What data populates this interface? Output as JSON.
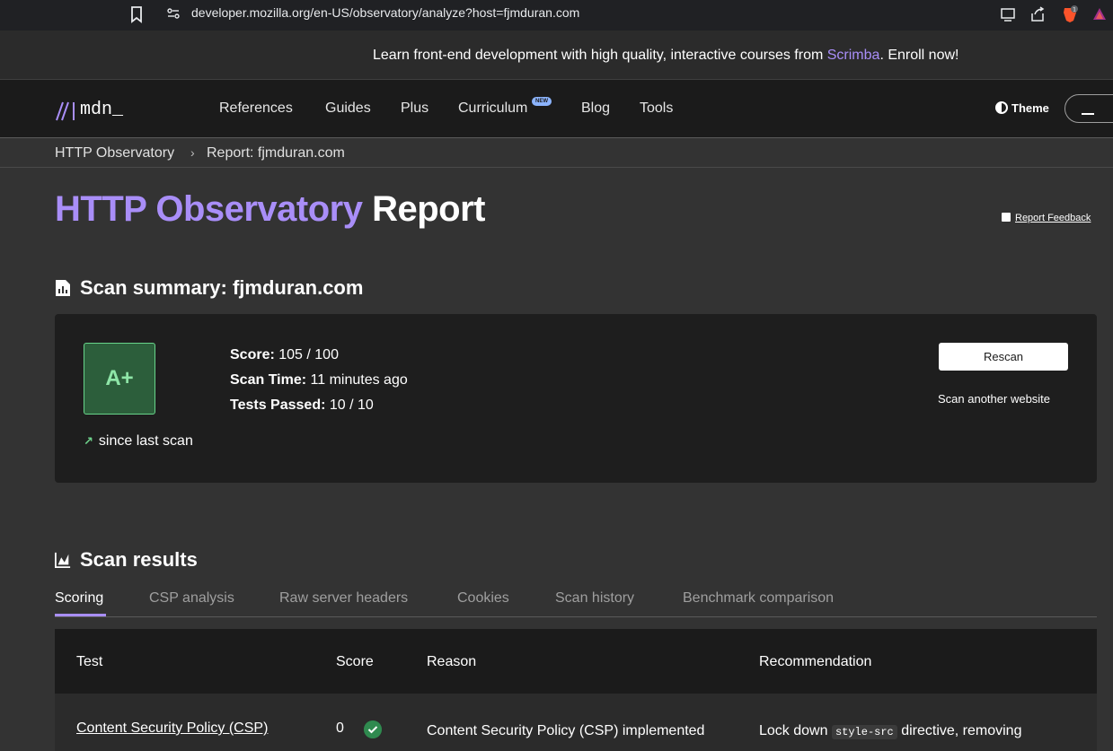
{
  "browser": {
    "url": "developer.mozilla.org/en-US/observatory/analyze?host=fjmduran.com",
    "icons": [
      "bookmark-icon",
      "site-info-icon",
      "install-icon",
      "share-icon",
      "brave-shield-icon",
      "brave-rewards-icon"
    ],
    "shield_count": "1"
  },
  "banner": {
    "before": "Learn front-end development with high quality, interactive courses from ",
    "link": "Scrimba",
    "after": ". Enroll now!"
  },
  "nav": {
    "logo": "mdn_",
    "items": [
      "References",
      "Guides",
      "Plus",
      "Curriculum",
      "Blog",
      "Tools"
    ],
    "new_badge": "NEW",
    "theme": "Theme"
  },
  "breadcrumb": {
    "items": [
      "HTTP Observatory",
      "Report: fjmduran.com"
    ],
    "separator": "›"
  },
  "title": {
    "accent": "HTTP Observatory",
    "rest": " Report"
  },
  "feedback": "Report Feedback",
  "summary": {
    "heading_bold": "Scan summary:",
    "heading_host": " fjmduran.com",
    "grade": "A+",
    "since_last_scan": "since last scan",
    "score_label": "Score:",
    "score_value": " 105 / 100",
    "scan_time_label": "Scan Time:",
    "scan_time_value": " 11 minutes ago",
    "tests_label": "Tests Passed:",
    "tests_value": " 10 / 10",
    "rescan": "Rescan",
    "scan_another": "Scan another website"
  },
  "results": {
    "heading": "Scan results",
    "tabs": [
      "Scoring",
      "CSP analysis",
      "Raw server headers",
      "Cookies",
      "Scan history",
      "Benchmark comparison"
    ],
    "active_tab": 0,
    "columns": [
      "Test",
      "Score",
      "Reason",
      "Recommendation"
    ],
    "rows": [
      {
        "test": "Content Security Policy (CSP)",
        "score": "0",
        "reason": "Content Security Policy (CSP) implemented",
        "reco_before": "Lock down ",
        "reco_code": "style-src",
        "reco_after": " directive, removing"
      }
    ]
  },
  "colors": {
    "accent": "#a98ef8",
    "background": "#333333",
    "card": "#1e1e1e",
    "grade_bg": "#2c5e3b",
    "grade_text": "#8fe6a8",
    "pass": "#2f8a4f"
  }
}
